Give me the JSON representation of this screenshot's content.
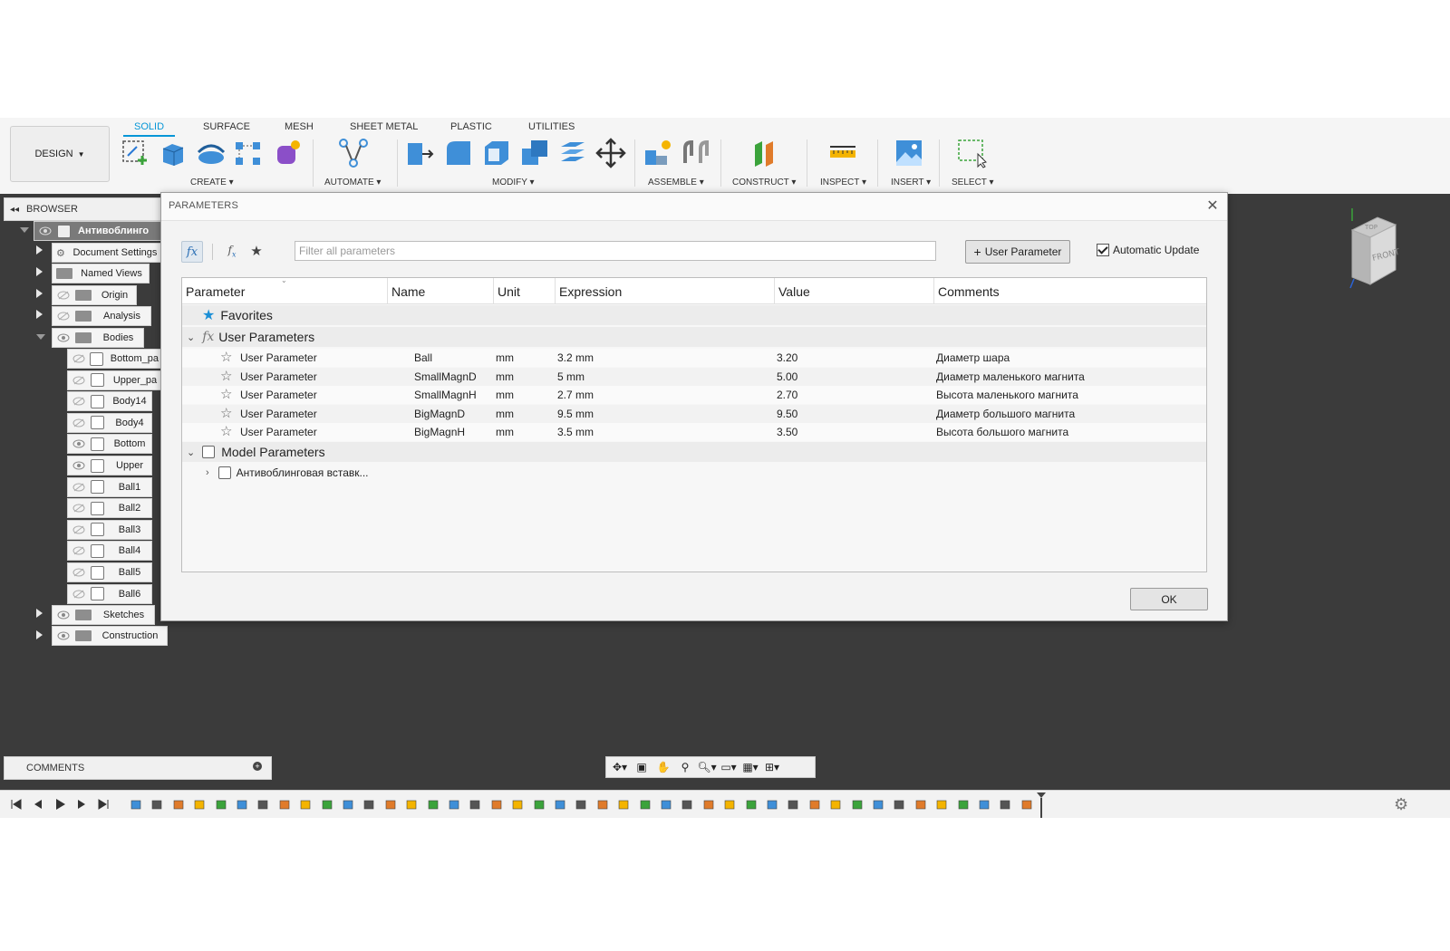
{
  "toolbar": {
    "workspace_label": "DESIGN",
    "tabs": [
      "SOLID",
      "SURFACE",
      "MESH",
      "SHEET METAL",
      "PLASTIC",
      "UTILITIES"
    ],
    "active_tab": "SOLID",
    "groups": [
      "CREATE",
      "AUTOMATE",
      "MODIFY",
      "ASSEMBLE",
      "CONSTRUCT",
      "INSPECT",
      "INSERT",
      "SELECT"
    ]
  },
  "browser": {
    "title": "BROWSER",
    "root": "Антивоблинго",
    "items": [
      "Document Settings",
      "Named Views",
      "Origin",
      "Analysis",
      "Bodies"
    ],
    "bodies": [
      "Bottom_pa",
      "Upper_pa",
      "Body14",
      "Body4",
      "Bottom",
      "Upper",
      "Ball1",
      "Ball2",
      "Ball3",
      "Ball4",
      "Ball5",
      "Ball6"
    ],
    "tail": [
      "Sketches",
      "Construction"
    ]
  },
  "comments": {
    "label": "COMMENTS"
  },
  "dialog": {
    "title": "PARAMETERS",
    "filter_placeholder": "Filter all parameters",
    "add_button": "User Parameter",
    "auto_update_label": "Automatic Update",
    "auto_update_checked": true,
    "ok_label": "OK",
    "columns": [
      "Parameter",
      "Name",
      "Unit",
      "Expression",
      "Value",
      "Comments"
    ],
    "sections": {
      "favorites": "Favorites",
      "user": "User Parameters",
      "model": "Model Parameters",
      "model_child": "Антивоблинговая вставк..."
    },
    "rows": [
      {
        "parameter": "User Parameter",
        "name": "Ball",
        "unit": "mm",
        "expression": "3.2 mm",
        "value": "3.20",
        "comment": "Диаметр шара"
      },
      {
        "parameter": "User Parameter",
        "name": "SmallMagnD",
        "unit": "mm",
        "expression": "5 mm",
        "value": "5.00",
        "comment": "Диаметр маленького магнита"
      },
      {
        "parameter": "User Parameter",
        "name": "SmallMagnH",
        "unit": "mm",
        "expression": "2.7 mm",
        "value": "2.70",
        "comment": "Высота маленького магнита"
      },
      {
        "parameter": "User Parameter",
        "name": "BigMagnD",
        "unit": "mm",
        "expression": "9.5 mm",
        "value": "9.50",
        "comment": "Диаметр большого магнита"
      },
      {
        "parameter": "User Parameter",
        "name": "BigMagnH",
        "unit": "mm",
        "expression": "3.5 mm",
        "value": "3.50",
        "comment": "Высота большого магнита"
      }
    ]
  },
  "viewcube": {
    "top": "TOP",
    "front": "FRONT"
  },
  "colors": {
    "accent": "#0696d7",
    "canvas": "#3b3b3b"
  }
}
